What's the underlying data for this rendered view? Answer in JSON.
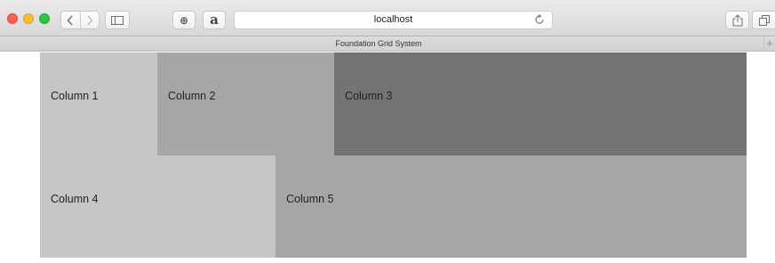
{
  "browser": {
    "url": "localhost",
    "tab_title": "Foundation Grid System",
    "new_tab_glyph": "+",
    "icons": {
      "back": "chevron-left-icon",
      "forward": "chevron-right-icon",
      "sidebar": "sidebar-icon",
      "extension_1": "instapaper-icon",
      "extension_2": "amazon-a-icon",
      "reload": "reload-icon",
      "share": "share-icon",
      "tabs": "tabs-icon"
    },
    "extension_1_glyph": "⊕",
    "extension_2_glyph": "a"
  },
  "grid": {
    "rows": [
      {
        "columns": [
          {
            "label": "Column 1",
            "color": "#c6c6c6"
          },
          {
            "label": "Column 2",
            "color": "#a6a6a6"
          },
          {
            "label": "Column 3",
            "color": "#747474"
          }
        ]
      },
      {
        "columns": [
          {
            "label": "Column 4",
            "color": "#c6c6c6"
          },
          {
            "label": "Column 5",
            "color": "#a6a6a6"
          }
        ]
      }
    ]
  }
}
